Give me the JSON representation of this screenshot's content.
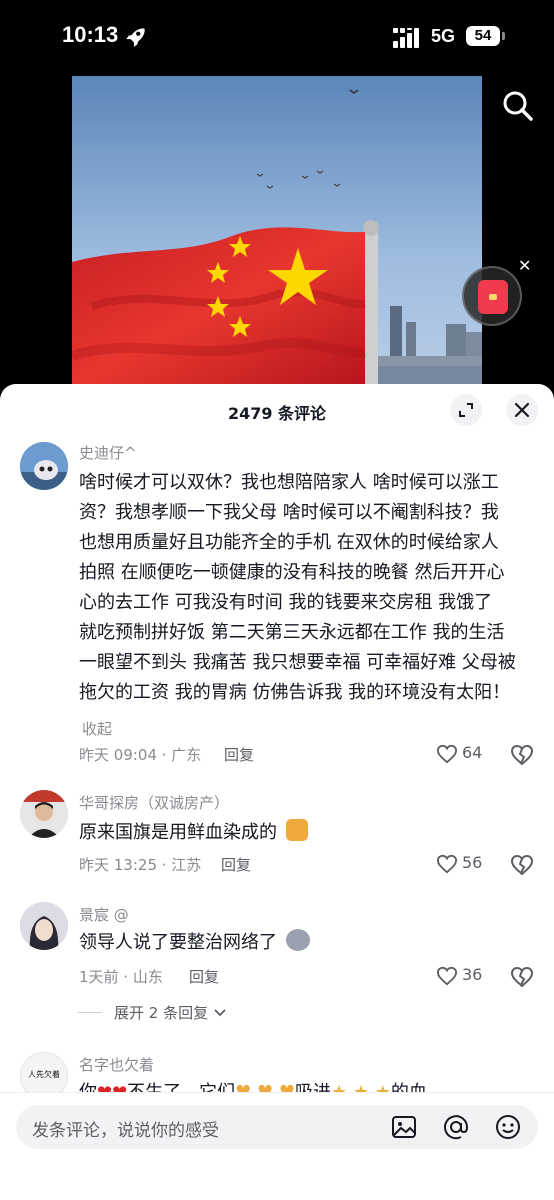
{
  "status": {
    "time": "10:13",
    "network": "5G",
    "battery": "54"
  },
  "sheet": {
    "title": "2479 条评论"
  },
  "comments": [
    {
      "name": "史迪仔^",
      "text_lines": [
        "啥时候才可以双休？我也想陪陪家人 啥时候可以涨工",
        "资？我想孝顺一下我父母 啥时候可以不阉割科技？我",
        "也想用质量好且功能齐全的手机 在双休的时候给家人",
        "拍照 在顺便吃一顿健康的没有科技的晚餐 然后开开心",
        "心的去工作 可我没有时间 我的钱要来交房租 我饿了",
        "就吃预制拼好饭 第二天第三天永远都在工作 我的生活",
        "一眼望不到头 我痛苦 我只想要幸福 可幸福好难 父母被",
        "拖欠的工资 我的胃病 仿佛告诉我 我的环境没有太阳！"
      ],
      "collapse": "收起",
      "meta": "昨天 09:04 · 广东",
      "reply": "回复",
      "likes": "64"
    },
    {
      "name": "华哥探房（双诚房产）",
      "text": "原来国旗是用鲜血染成的",
      "meta": "昨天 13:25 · 江苏",
      "reply": "回复",
      "likes": "56"
    },
    {
      "name": "景宸 @",
      "text": "领导人说了要整治网络了",
      "meta": "1天前 · 山东",
      "reply": "回复",
      "likes": "36",
      "expand": "展开 2 条回复"
    },
    {
      "name": "名字也欠着",
      "text_a": "你",
      "text_b": "不生了，它们",
      "text_c": "吸进",
      "text_d": "的血",
      "avatar_text": "人先欠着"
    }
  ],
  "input": {
    "placeholder": "发条评论，说说你的感受"
  },
  "colors": {
    "flag_red": "#d8262b",
    "star": "#ffd700",
    "accent_red": "#fe2c55"
  }
}
